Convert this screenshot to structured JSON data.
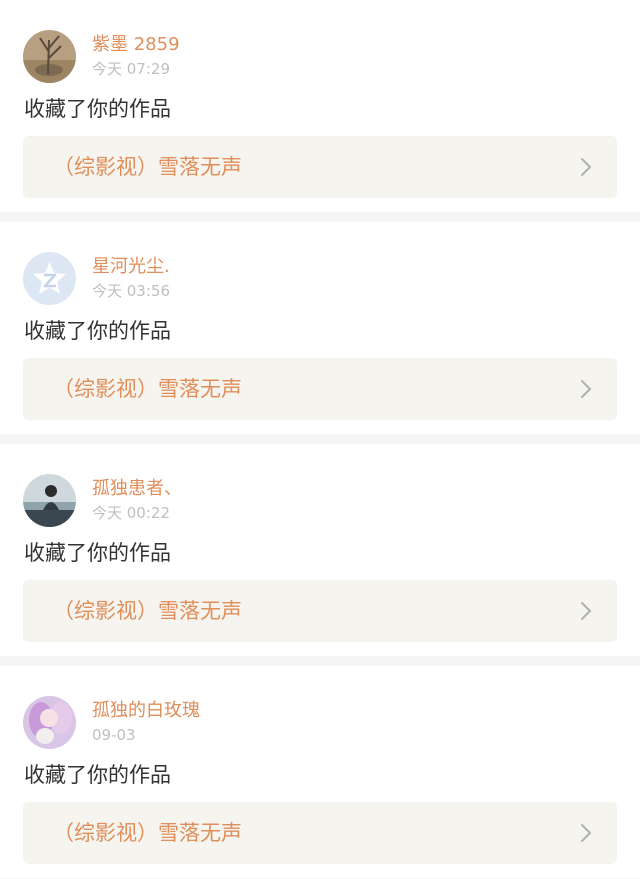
{
  "notifications": [
    {
      "username": "紫墨 2859",
      "time": "今天 07:29",
      "action": "收藏了你的作品",
      "work_title": "（综影视）雪落无声"
    },
    {
      "username": "星河光尘.",
      "time": "今天 03:56",
      "action": "收藏了你的作品",
      "work_title": "（综影视）雪落无声"
    },
    {
      "username": "孤独患者、",
      "time": "今天 00:22",
      "action": "收藏了你的作品",
      "work_title": "（综影视）雪落无声"
    },
    {
      "username": "孤独的白玫瑰",
      "time": "09-03",
      "action": "收藏了你的作品",
      "work_title": "（综影视）雪落无声"
    }
  ],
  "icons": {
    "chevron": "chevron-right-icon",
    "default_avatar": "qzone-star-icon"
  },
  "colors": {
    "username": "#e08e5a",
    "timestamp": "#bfbfbf",
    "work_card_bg": "#f5f4ef",
    "separator": "#f5f5f5"
  }
}
